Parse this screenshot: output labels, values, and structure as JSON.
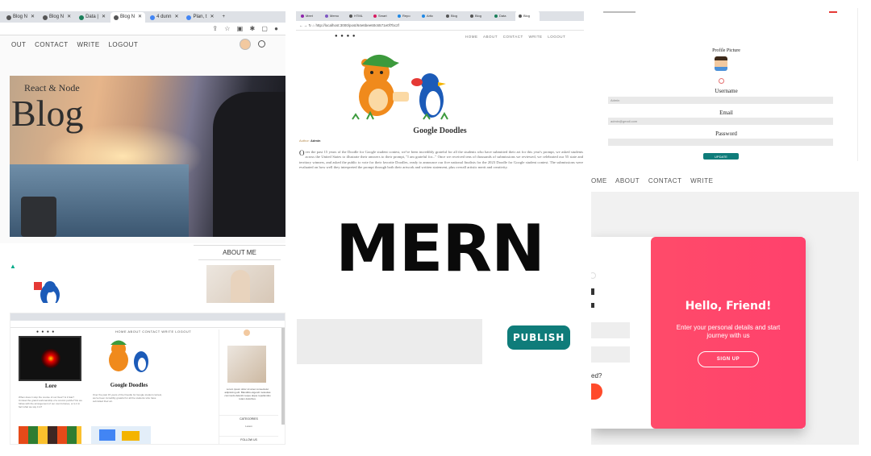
{
  "left_panel": {
    "tabs": [
      "Blog N",
      "Blog N",
      "Data |",
      "Blog N",
      "4 dunn",
      "Plan, t"
    ],
    "nav": [
      "OUT",
      "CONTACT",
      "WRITE",
      "LOGOUT"
    ],
    "hero_subtitle": "React & Node",
    "hero_title": "Blog",
    "about_heading": "ABOUT ME"
  },
  "center_top": {
    "tabs": [
      "Meet",
      "Memo",
      "HTML",
      "Smart",
      "Repo",
      "Artic",
      "Blog",
      "Blog",
      "Data",
      "Blog"
    ],
    "address": "http://localhost:3000/post/64e6bee60c6571e0f7bc2f",
    "nav": [
      "HOME",
      "ABOUT",
      "CONTACT",
      "WRITE",
      "LOGOUT"
    ],
    "post_title": "Google Doodles",
    "author_label": "Author:",
    "author_name": "Admin",
    "body_dropcap": "O",
    "body": "ver the past 15 years of the Doodle for Google student contest, we've been incredibly grateful for all the students who have submitted their art for this year's prompt, we asked students across the United States to illustrate their answers to their prompt, \"I am grateful for...\" Once we received tens of thousands of submissions we reviewed, we celebrated our 55 state and territory winners, and asked the public to vote for their favorite Doodles, ready to announce our five national finalists for the 2023 Doodle for Google student contest. The submissions were evaluated on how well they interpreted the prompt through both their artwork and written statement, plus overall artistic merit and creativity."
  },
  "right_top": {
    "profile_label": "Profile Picture",
    "username_label": "Username",
    "username_value": "Admin",
    "email_label": "Email",
    "email_value": "admin@gmail.com",
    "password_label": "Password",
    "update_button": "UPDATE"
  },
  "right_bottom": {
    "nav": [
      "OME",
      "ABOUT",
      "CONTACT",
      "WRITE"
    ],
    "overlay_title": "Hello, Friend!",
    "overlay_text": "Enter your personal details and start journey with us",
    "signup_button": "SIGN UP",
    "partial_text": "ed?"
  },
  "center": {
    "title": "MERN",
    "publish_button": "PUBLISH"
  },
  "bottom_left": {
    "post1_title": "Lore",
    "post1_excerpt": "When does it stop the course of our lives? Is it fate? Unravel the grand workmanship of a cosmic puzzle? Do we follow with the arrangement of our own fortunes, or is it in fact what we say it is?",
    "post2_title": "Google Doodles",
    "post2_excerpt": "Over the past 15 years of the Doodle for Google student contest, we've been incredibly grateful for all the students who have submitted their art.",
    "sidebar_text": "Lorem ipsum dolor sit amet consectetur adipisicing elit. Blanditiis eligendi molestias commodo deleniti neque atque repellendus totam doloribus.",
    "categories_label": "CATEGORIES",
    "category_item": "Lorem",
    "follow_label": "FOLLOW US"
  },
  "colors": {
    "teal": "#0f7c7a",
    "coral": "#ff4b6a",
    "hero_dark": "#3a3a3a"
  }
}
